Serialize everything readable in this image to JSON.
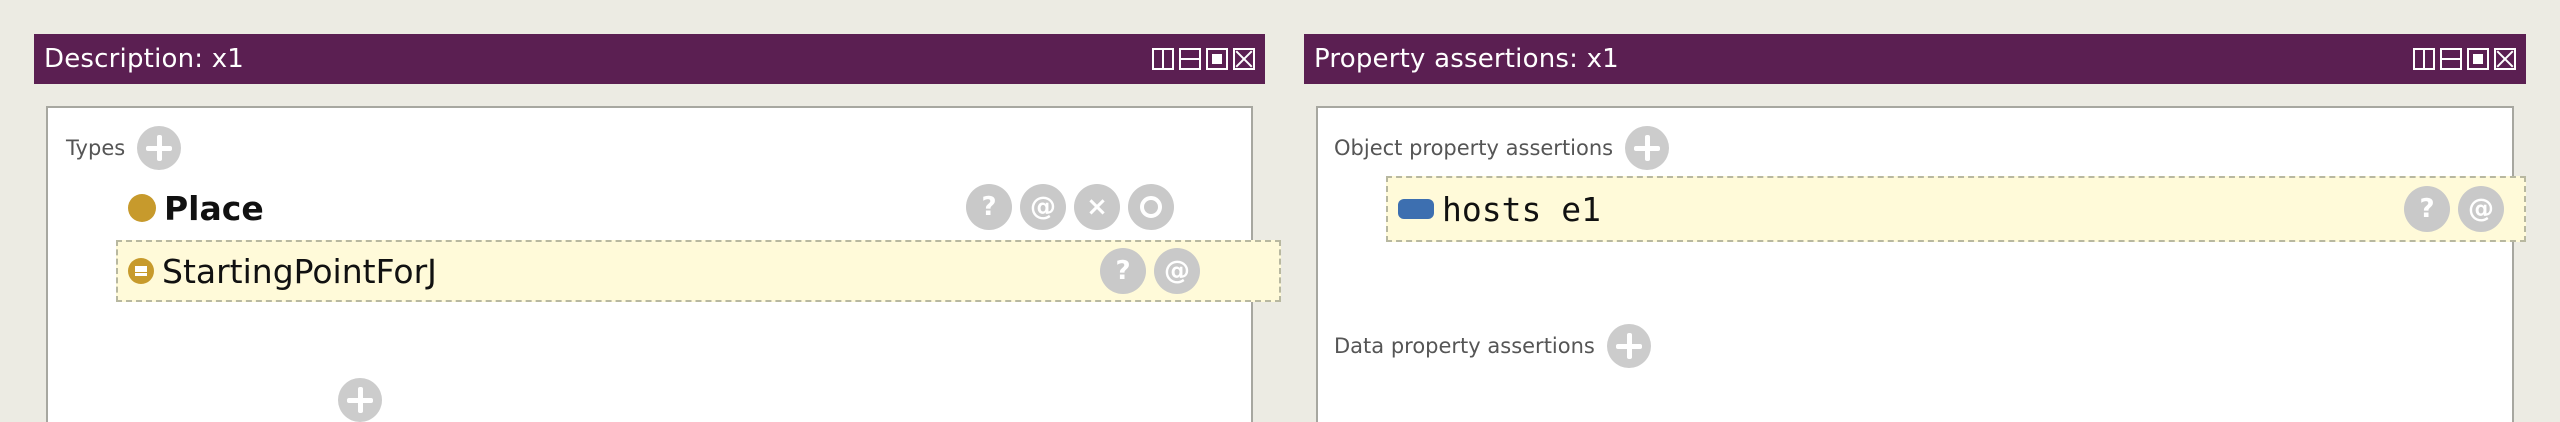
{
  "left_panel": {
    "title": "Description: x1",
    "types_label": "Types",
    "types": [
      {
        "label": "Place",
        "icon": "class-icon"
      },
      {
        "label": "StartingPointForJ",
        "icon": "equivalent-class-icon"
      }
    ]
  },
  "right_panel": {
    "title": "Property assertions: x1",
    "object_props_label": "Object property assertions",
    "object_props": [
      {
        "label": "hosts e1",
        "icon": "object-property-icon"
      }
    ],
    "data_props_label": "Data property assertions"
  },
  "actions": {
    "explain": "?",
    "annotate": "@",
    "delete": "×"
  },
  "colors": {
    "titlebar": "#5b1f52",
    "class_dot": "#c79a2c",
    "object_property": "#3d6fb0",
    "highlight": "#fffad9"
  }
}
